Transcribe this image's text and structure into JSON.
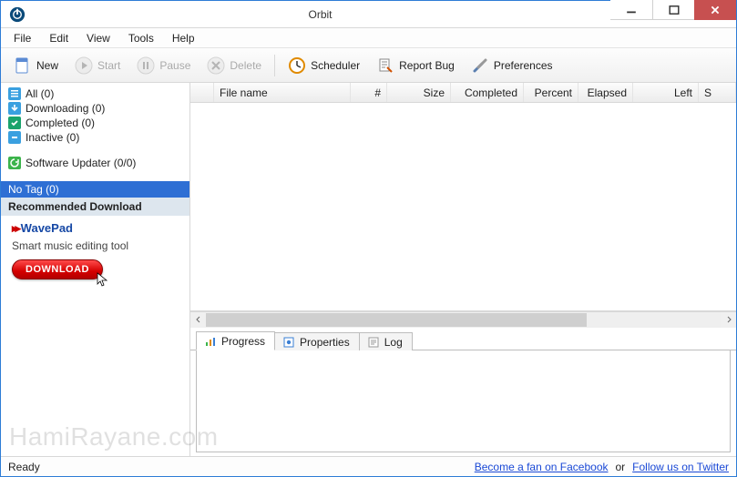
{
  "window": {
    "title": "Orbit",
    "app_icon": "orbit-icon"
  },
  "menubar": {
    "items": [
      "File",
      "Edit",
      "View",
      "Tools",
      "Help"
    ]
  },
  "toolbar": {
    "new": "New",
    "start": "Start",
    "pause": "Pause",
    "delete": "Delete",
    "scheduler": "Scheduler",
    "report_bug": "Report Bug",
    "preferences": "Preferences"
  },
  "sidebar": {
    "all": "All (0)",
    "downloading": "Downloading (0)",
    "completed": "Completed (0)",
    "inactive": "Inactive (0)",
    "updater": "Software Updater (0/0)",
    "no_tag": "No Tag (0)",
    "rec_header": "Recommended Download",
    "rec_title": "WavePad",
    "rec_sub": "Smart music editing tool",
    "rec_btn": "DOWNLOAD"
  },
  "grid": {
    "columns": [
      {
        "label": "",
        "w": 26,
        "align": "l"
      },
      {
        "label": "File name",
        "w": 150,
        "align": "l"
      },
      {
        "label": "#",
        "w": 40,
        "align": "r"
      },
      {
        "label": "Size",
        "w": 70,
        "align": "r"
      },
      {
        "label": "Completed",
        "w": 80,
        "align": "r"
      },
      {
        "label": "Percent",
        "w": 60,
        "align": "r"
      },
      {
        "label": "Elapsed",
        "w": 60,
        "align": "r"
      },
      {
        "label": "Left",
        "w": 72,
        "align": "r"
      },
      {
        "label": "S",
        "w": 20,
        "align": "l"
      }
    ],
    "rows": []
  },
  "detail_tabs": {
    "items": [
      {
        "label": "Progress",
        "icon": "chart-icon"
      },
      {
        "label": "Properties",
        "icon": "properties-icon"
      },
      {
        "label": "Log",
        "icon": "log-icon"
      }
    ],
    "active": 0
  },
  "status": {
    "ready": "Ready",
    "fb": "Become a fan on Facebook",
    "or": "or",
    "tw": "Follow us on Twitter"
  },
  "watermark": "HamiRayane.com",
  "colors": {
    "accent": "#2e6fd4",
    "close": "#c75050",
    "download_btn": "#d40000",
    "link": "#1a49d6"
  }
}
